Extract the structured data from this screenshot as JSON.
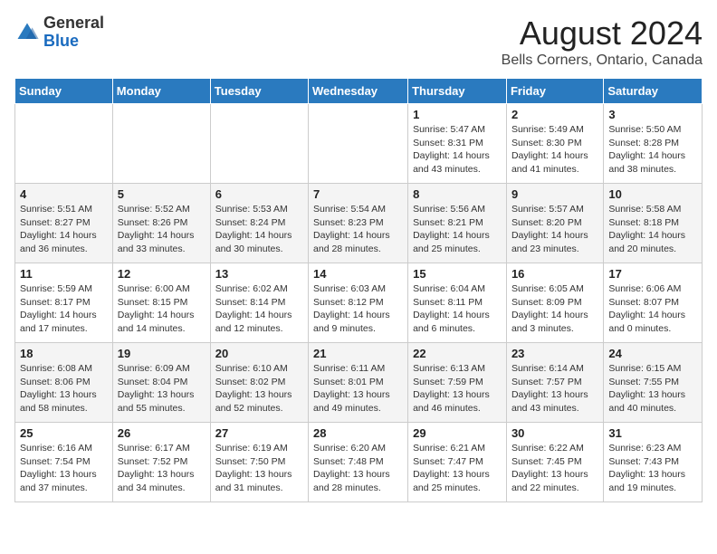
{
  "header": {
    "logo_general": "General",
    "logo_blue": "Blue",
    "month_title": "August 2024",
    "location": "Bells Corners, Ontario, Canada"
  },
  "days_of_week": [
    "Sunday",
    "Monday",
    "Tuesday",
    "Wednesday",
    "Thursday",
    "Friday",
    "Saturday"
  ],
  "weeks": [
    [
      {
        "day": "",
        "info": ""
      },
      {
        "day": "",
        "info": ""
      },
      {
        "day": "",
        "info": ""
      },
      {
        "day": "",
        "info": ""
      },
      {
        "day": "1",
        "info": "Sunrise: 5:47 AM\nSunset: 8:31 PM\nDaylight: 14 hours and 43 minutes."
      },
      {
        "day": "2",
        "info": "Sunrise: 5:49 AM\nSunset: 8:30 PM\nDaylight: 14 hours and 41 minutes."
      },
      {
        "day": "3",
        "info": "Sunrise: 5:50 AM\nSunset: 8:28 PM\nDaylight: 14 hours and 38 minutes."
      }
    ],
    [
      {
        "day": "4",
        "info": "Sunrise: 5:51 AM\nSunset: 8:27 PM\nDaylight: 14 hours and 36 minutes."
      },
      {
        "day": "5",
        "info": "Sunrise: 5:52 AM\nSunset: 8:26 PM\nDaylight: 14 hours and 33 minutes."
      },
      {
        "day": "6",
        "info": "Sunrise: 5:53 AM\nSunset: 8:24 PM\nDaylight: 14 hours and 30 minutes."
      },
      {
        "day": "7",
        "info": "Sunrise: 5:54 AM\nSunset: 8:23 PM\nDaylight: 14 hours and 28 minutes."
      },
      {
        "day": "8",
        "info": "Sunrise: 5:56 AM\nSunset: 8:21 PM\nDaylight: 14 hours and 25 minutes."
      },
      {
        "day": "9",
        "info": "Sunrise: 5:57 AM\nSunset: 8:20 PM\nDaylight: 14 hours and 23 minutes."
      },
      {
        "day": "10",
        "info": "Sunrise: 5:58 AM\nSunset: 8:18 PM\nDaylight: 14 hours and 20 minutes."
      }
    ],
    [
      {
        "day": "11",
        "info": "Sunrise: 5:59 AM\nSunset: 8:17 PM\nDaylight: 14 hours and 17 minutes."
      },
      {
        "day": "12",
        "info": "Sunrise: 6:00 AM\nSunset: 8:15 PM\nDaylight: 14 hours and 14 minutes."
      },
      {
        "day": "13",
        "info": "Sunrise: 6:02 AM\nSunset: 8:14 PM\nDaylight: 14 hours and 12 minutes."
      },
      {
        "day": "14",
        "info": "Sunrise: 6:03 AM\nSunset: 8:12 PM\nDaylight: 14 hours and 9 minutes."
      },
      {
        "day": "15",
        "info": "Sunrise: 6:04 AM\nSunset: 8:11 PM\nDaylight: 14 hours and 6 minutes."
      },
      {
        "day": "16",
        "info": "Sunrise: 6:05 AM\nSunset: 8:09 PM\nDaylight: 14 hours and 3 minutes."
      },
      {
        "day": "17",
        "info": "Sunrise: 6:06 AM\nSunset: 8:07 PM\nDaylight: 14 hours and 0 minutes."
      }
    ],
    [
      {
        "day": "18",
        "info": "Sunrise: 6:08 AM\nSunset: 8:06 PM\nDaylight: 13 hours and 58 minutes."
      },
      {
        "day": "19",
        "info": "Sunrise: 6:09 AM\nSunset: 8:04 PM\nDaylight: 13 hours and 55 minutes."
      },
      {
        "day": "20",
        "info": "Sunrise: 6:10 AM\nSunset: 8:02 PM\nDaylight: 13 hours and 52 minutes."
      },
      {
        "day": "21",
        "info": "Sunrise: 6:11 AM\nSunset: 8:01 PM\nDaylight: 13 hours and 49 minutes."
      },
      {
        "day": "22",
        "info": "Sunrise: 6:13 AM\nSunset: 7:59 PM\nDaylight: 13 hours and 46 minutes."
      },
      {
        "day": "23",
        "info": "Sunrise: 6:14 AM\nSunset: 7:57 PM\nDaylight: 13 hours and 43 minutes."
      },
      {
        "day": "24",
        "info": "Sunrise: 6:15 AM\nSunset: 7:55 PM\nDaylight: 13 hours and 40 minutes."
      }
    ],
    [
      {
        "day": "25",
        "info": "Sunrise: 6:16 AM\nSunset: 7:54 PM\nDaylight: 13 hours and 37 minutes."
      },
      {
        "day": "26",
        "info": "Sunrise: 6:17 AM\nSunset: 7:52 PM\nDaylight: 13 hours and 34 minutes."
      },
      {
        "day": "27",
        "info": "Sunrise: 6:19 AM\nSunset: 7:50 PM\nDaylight: 13 hours and 31 minutes."
      },
      {
        "day": "28",
        "info": "Sunrise: 6:20 AM\nSunset: 7:48 PM\nDaylight: 13 hours and 28 minutes."
      },
      {
        "day": "29",
        "info": "Sunrise: 6:21 AM\nSunset: 7:47 PM\nDaylight: 13 hours and 25 minutes."
      },
      {
        "day": "30",
        "info": "Sunrise: 6:22 AM\nSunset: 7:45 PM\nDaylight: 13 hours and 22 minutes."
      },
      {
        "day": "31",
        "info": "Sunrise: 6:23 AM\nSunset: 7:43 PM\nDaylight: 13 hours and 19 minutes."
      }
    ]
  ]
}
